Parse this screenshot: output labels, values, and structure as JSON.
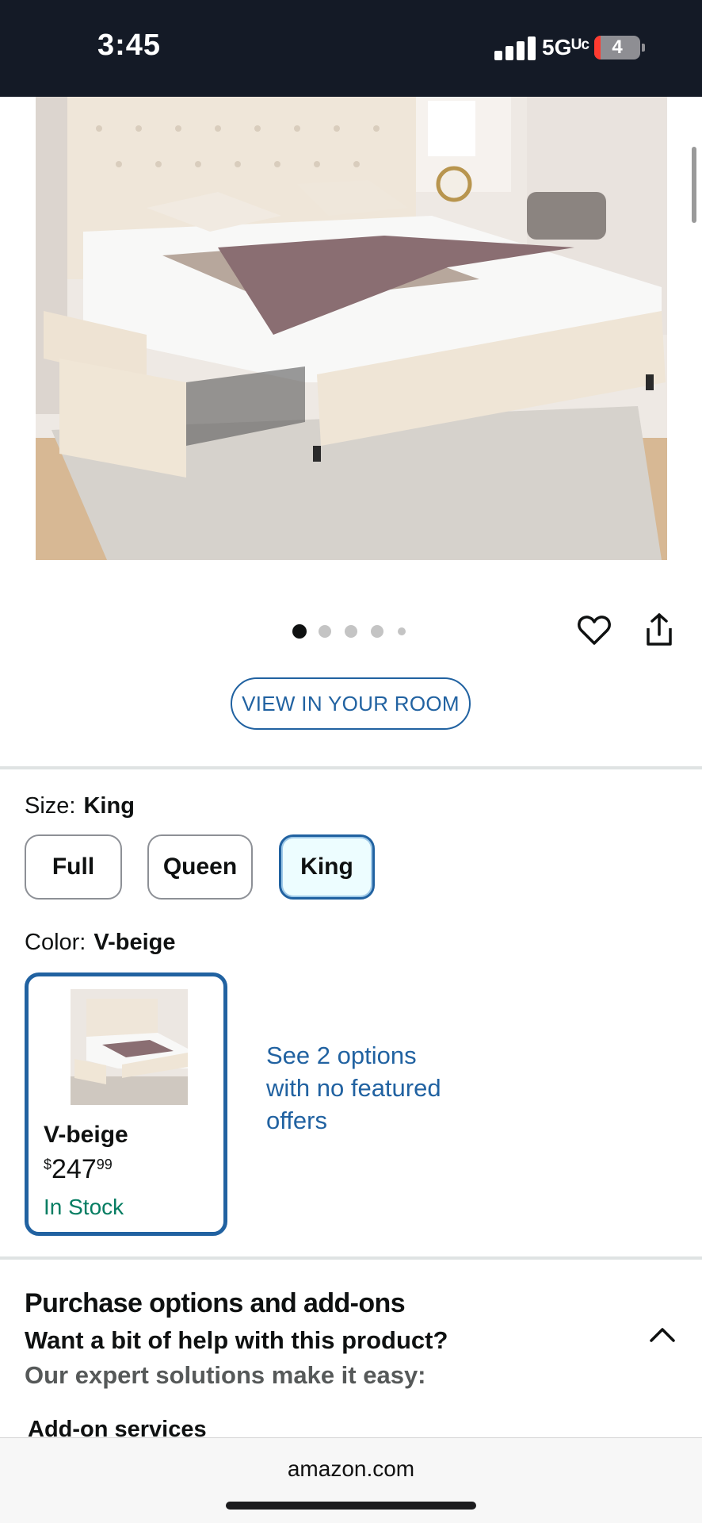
{
  "status_bar": {
    "time": "3:45",
    "network": "5Gᵁᶜ",
    "battery": "4"
  },
  "product": {
    "image_alt": "Beige tufted upholstered king bed with four storage drawers",
    "carousel": {
      "count": 5,
      "active_index": 0
    },
    "view_in_room_label": "VIEW IN YOUR ROOM"
  },
  "size": {
    "label": "Size:",
    "selected": "King",
    "options": [
      {
        "label": "Full"
      },
      {
        "label": "Queen"
      },
      {
        "label": "King"
      }
    ]
  },
  "color": {
    "label": "Color:",
    "selected": "V-beige",
    "card": {
      "name": "V-beige",
      "price_symbol": "$",
      "price_whole": "247",
      "price_fraction": "99",
      "stock": "In Stock"
    },
    "see_options": "See 2 options with no featured offers"
  },
  "purchase_options": {
    "title": "Purchase options and add-ons",
    "subtitle": "Want a bit of help with this product?",
    "subtitle2": "Our expert solutions make it easy:",
    "addon_heading": "Add-on services"
  },
  "browser": {
    "url": "amazon.com"
  },
  "colors": {
    "link_blue": "#2162a1",
    "stock_green": "#067d62",
    "status_bar": "#141a26"
  }
}
